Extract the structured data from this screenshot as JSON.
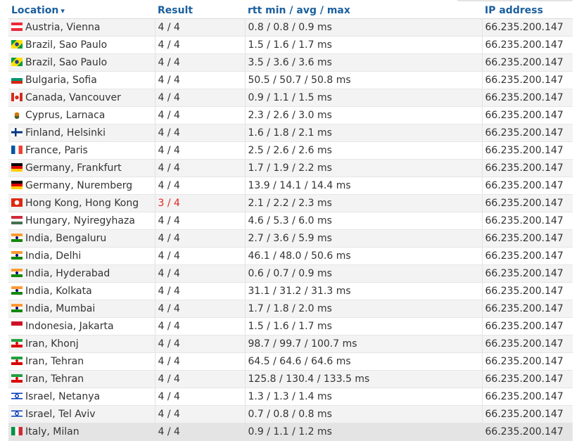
{
  "header": {
    "location": "Location",
    "sort_arrow": "▾",
    "result": "Result",
    "rtt": "rtt min / avg / max",
    "ip": "IP address"
  },
  "colors": {
    "header_text": "#1b5f9e",
    "warning_result": "#e0261f"
  },
  "rows": [
    {
      "flag": "at-flag-icon",
      "location": "Austria, Vienna",
      "result": "4 / 4",
      "rtt": "0.8 / 0.8 / 0.9 ms",
      "ip": "66.235.200.147"
    },
    {
      "flag": "br-flag-icon",
      "location": "Brazil, Sao Paulo",
      "result": "4 / 4",
      "rtt": "1.5 / 1.6 / 1.7 ms",
      "ip": "66.235.200.147"
    },
    {
      "flag": "br-flag-icon",
      "location": "Brazil, Sao Paulo",
      "result": "4 / 4",
      "rtt": "3.5 / 3.6 / 3.6 ms",
      "ip": "66.235.200.147"
    },
    {
      "flag": "bg-flag-icon",
      "location": "Bulgaria, Sofia",
      "result": "4 / 4",
      "rtt": "50.5 / 50.7 / 50.8 ms",
      "ip": "66.235.200.147"
    },
    {
      "flag": "ca-flag-icon",
      "location": "Canada, Vancouver",
      "result": "4 / 4",
      "rtt": "0.9 / 1.1 / 1.5 ms",
      "ip": "66.235.200.147"
    },
    {
      "flag": "cy-flag-icon",
      "location": "Cyprus, Larnaca",
      "result": "4 / 4",
      "rtt": "2.3 / 2.6 / 3.0 ms",
      "ip": "66.235.200.147"
    },
    {
      "flag": "fi-flag-icon",
      "location": "Finland, Helsinki",
      "result": "4 / 4",
      "rtt": "1.6 / 1.8 / 2.1 ms",
      "ip": "66.235.200.147"
    },
    {
      "flag": "fr-flag-icon",
      "location": "France, Paris",
      "result": "4 / 4",
      "rtt": "2.5 / 2.6 / 2.6 ms",
      "ip": "66.235.200.147"
    },
    {
      "flag": "de-flag-icon",
      "location": "Germany, Frankfurt",
      "result": "4 / 4",
      "rtt": "1.7 / 1.9 / 2.2 ms",
      "ip": "66.235.200.147"
    },
    {
      "flag": "de-flag-icon",
      "location": "Germany, Nuremberg",
      "result": "4 / 4",
      "rtt": "13.9 / 14.1 / 14.4 ms",
      "ip": "66.235.200.147"
    },
    {
      "flag": "hk-flag-icon",
      "location": "Hong Kong, Hong Kong",
      "result": "3 / 4",
      "warn": true,
      "rtt": "2.1 / 2.2 / 2.3 ms",
      "ip": "66.235.200.147"
    },
    {
      "flag": "hu-flag-icon",
      "location": "Hungary, Nyiregyhaza",
      "result": "4 / 4",
      "rtt": "4.6 / 5.3 / 6.0 ms",
      "ip": "66.235.200.147"
    },
    {
      "flag": "in-flag-icon",
      "location": "India, Bengaluru",
      "result": "4 / 4",
      "rtt": "2.7 / 3.6 / 5.9 ms",
      "ip": "66.235.200.147"
    },
    {
      "flag": "in-flag-icon",
      "location": "India, Delhi",
      "result": "4 / 4",
      "rtt": "46.1 / 48.0 / 50.6 ms",
      "ip": "66.235.200.147"
    },
    {
      "flag": "in-flag-icon",
      "location": "India, Hyderabad",
      "result": "4 / 4",
      "rtt": "0.6 / 0.7 / 0.9 ms",
      "ip": "66.235.200.147"
    },
    {
      "flag": "in-flag-icon",
      "location": "India, Kolkata",
      "result": "4 / 4",
      "rtt": "31.1 / 31.2 / 31.3 ms",
      "ip": "66.235.200.147"
    },
    {
      "flag": "in-flag-icon",
      "location": "India, Mumbai",
      "result": "4 / 4",
      "rtt": "1.7 / 1.8 / 2.0 ms",
      "ip": "66.235.200.147"
    },
    {
      "flag": "id-flag-icon",
      "location": "Indonesia, Jakarta",
      "result": "4 / 4",
      "rtt": "1.5 / 1.6 / 1.7 ms",
      "ip": "66.235.200.147"
    },
    {
      "flag": "ir-flag-icon",
      "location": "Iran, Khonj",
      "result": "4 / 4",
      "rtt": "98.7 / 99.7 / 100.7 ms",
      "ip": "66.235.200.147"
    },
    {
      "flag": "ir-flag-icon",
      "location": "Iran, Tehran",
      "result": "4 / 4",
      "rtt": "64.5 / 64.6 / 64.6 ms",
      "ip": "66.235.200.147"
    },
    {
      "flag": "ir-flag-icon",
      "location": "Iran, Tehran",
      "result": "4 / 4",
      "rtt": "125.8 / 130.4 / 133.5 ms",
      "ip": "66.235.200.147"
    },
    {
      "flag": "il-flag-icon",
      "location": "Israel, Netanya",
      "result": "4 / 4",
      "rtt": "1.3 / 1.3 / 1.4 ms",
      "ip": "66.235.200.147"
    },
    {
      "flag": "il-flag-icon",
      "location": "Israel, Tel Aviv",
      "result": "4 / 4",
      "rtt": "0.7 / 0.8 / 0.8 ms",
      "ip": "66.235.200.147"
    },
    {
      "flag": "it-flag-icon",
      "location": "Italy, Milan",
      "result": "4 / 4",
      "rtt": "0.9 / 1.1 / 1.2 ms",
      "ip": "66.235.200.147"
    }
  ]
}
